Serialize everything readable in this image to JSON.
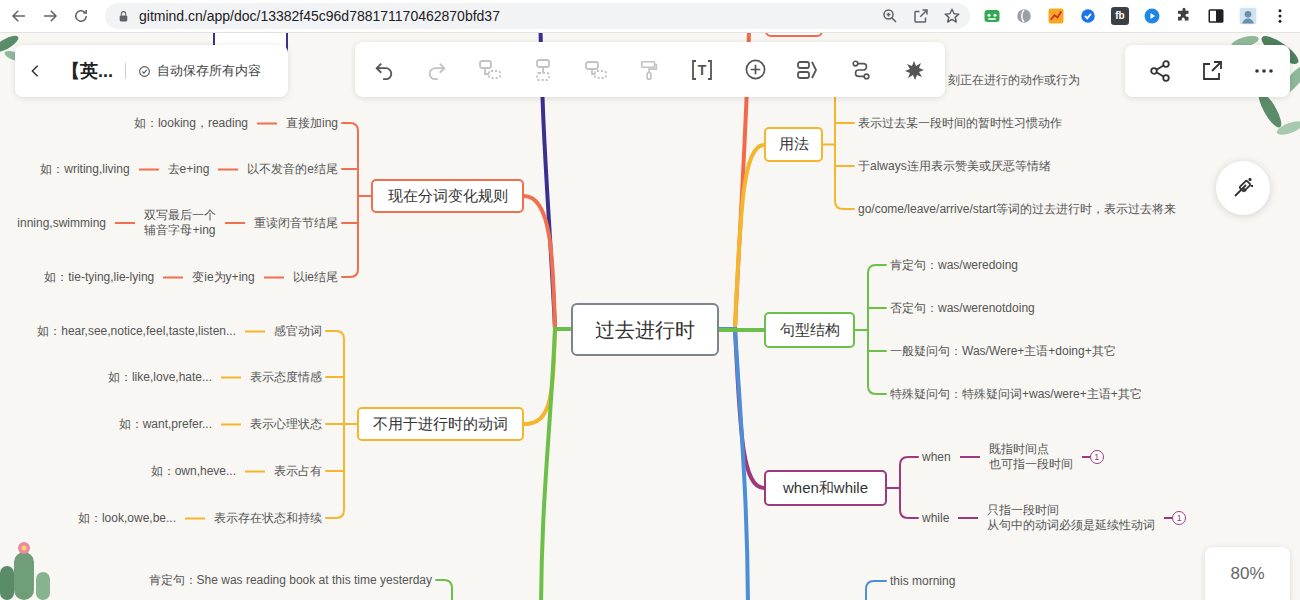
{
  "browser": {
    "url": "gitmind.cn/app/doc/13382f45c96d788171170462870bfd37",
    "starred": false,
    "extension_label": "fb"
  },
  "header": {
    "title": "【英...",
    "autosave": "自动保存所有内容"
  },
  "toolbar": {
    "buttons": [
      {
        "disabled": false
      },
      {
        "disabled": true
      },
      {
        "disabled": true
      },
      {
        "disabled": true
      },
      {
        "disabled": true
      },
      {
        "disabled": true
      },
      {
        "disabled": false,
        "glyph": "T"
      },
      {
        "disabled": false
      },
      {
        "disabled": false
      },
      {
        "disabled": false
      },
      {
        "disabled": false
      }
    ]
  },
  "zoom": "80%",
  "mindmap": {
    "root": "过去进行时",
    "left_branches": [
      {
        "kind": "node",
        "text": "现在分词变化规则",
        "color": "#ef6f4f",
        "rows": [
          {
            "text": "直接加ing",
            "example": "如：looking，reading"
          },
          {
            "text": "以不发音的e结尾",
            "middle": "去e+ing",
            "example": "如：writing,living"
          },
          {
            "text": "重读闭音节结尾",
            "middle": "双写最后一个\n辅音字母+ing",
            "example": "inning,swimming"
          },
          {
            "text": "以ie结尾",
            "middle": "变ie为y+ing",
            "example": "如：tie-tying,lie-lying"
          }
        ]
      },
      {
        "kind": "node",
        "text": "不用于进行时的动词",
        "color": "#f5b52e",
        "rows": [
          {
            "text": "感官动词",
            "example": "如：hear,see,notice,feel,taste,listen..."
          },
          {
            "text": "表示态度情感",
            "example": "如：like,love,hate..."
          },
          {
            "text": "表示心理状态",
            "example": "如：want,prefer..."
          },
          {
            "text": "表示占有",
            "example": "如：own,heve..."
          },
          {
            "text": "表示存在状态和持续",
            "example": "如：look,owe,be..."
          }
        ]
      },
      {
        "kind": "bare",
        "color": "#6cc04a",
        "rows": [
          {
            "text": "肯定句：She was reading book at this time yesterday"
          }
        ]
      },
      {
        "kind": "offscreen",
        "color": "#3b2f8f"
      }
    ],
    "right_branches": [
      {
        "kind": "offscreen",
        "color": "#f26a4a"
      },
      {
        "kind": "node",
        "text": "用法",
        "color": "#f5b52e",
        "rows": [
          {
            "text": "刻正在进行的动作或行为"
          },
          {
            "text": "表示过去某一段时间的暂时性习惯动作"
          },
          {
            "text": "于always连用表示赞美或厌恶等情绪"
          },
          {
            "text": "go/come/leave/arrive/start等词的过去进行时，表示过去将来"
          }
        ]
      },
      {
        "kind": "node",
        "text": "句型结构",
        "color": "#6cc04a",
        "rows": [
          {
            "text": "肯定句：was/weredoing"
          },
          {
            "text": "否定句：was/werenotdoing"
          },
          {
            "text": "一般疑问句：Was/Were+主语+doing+其它"
          },
          {
            "text": "特殊疑问句：特殊疑问词+was/were+主语+其它"
          }
        ]
      },
      {
        "kind": "node",
        "text": "when和while",
        "color": "#9c3a7c",
        "rows": [
          {
            "text": "when",
            "note": "既指时间点\n也可指一段时间",
            "badge": "1"
          },
          {
            "text": "while",
            "note": "只指一段时间\n从句中的动词必须是延续性动词",
            "badge": "1"
          }
        ]
      },
      {
        "kind": "bare",
        "color": "#4a8fd8",
        "rows": [
          {
            "text": "this morning"
          }
        ]
      }
    ]
  }
}
